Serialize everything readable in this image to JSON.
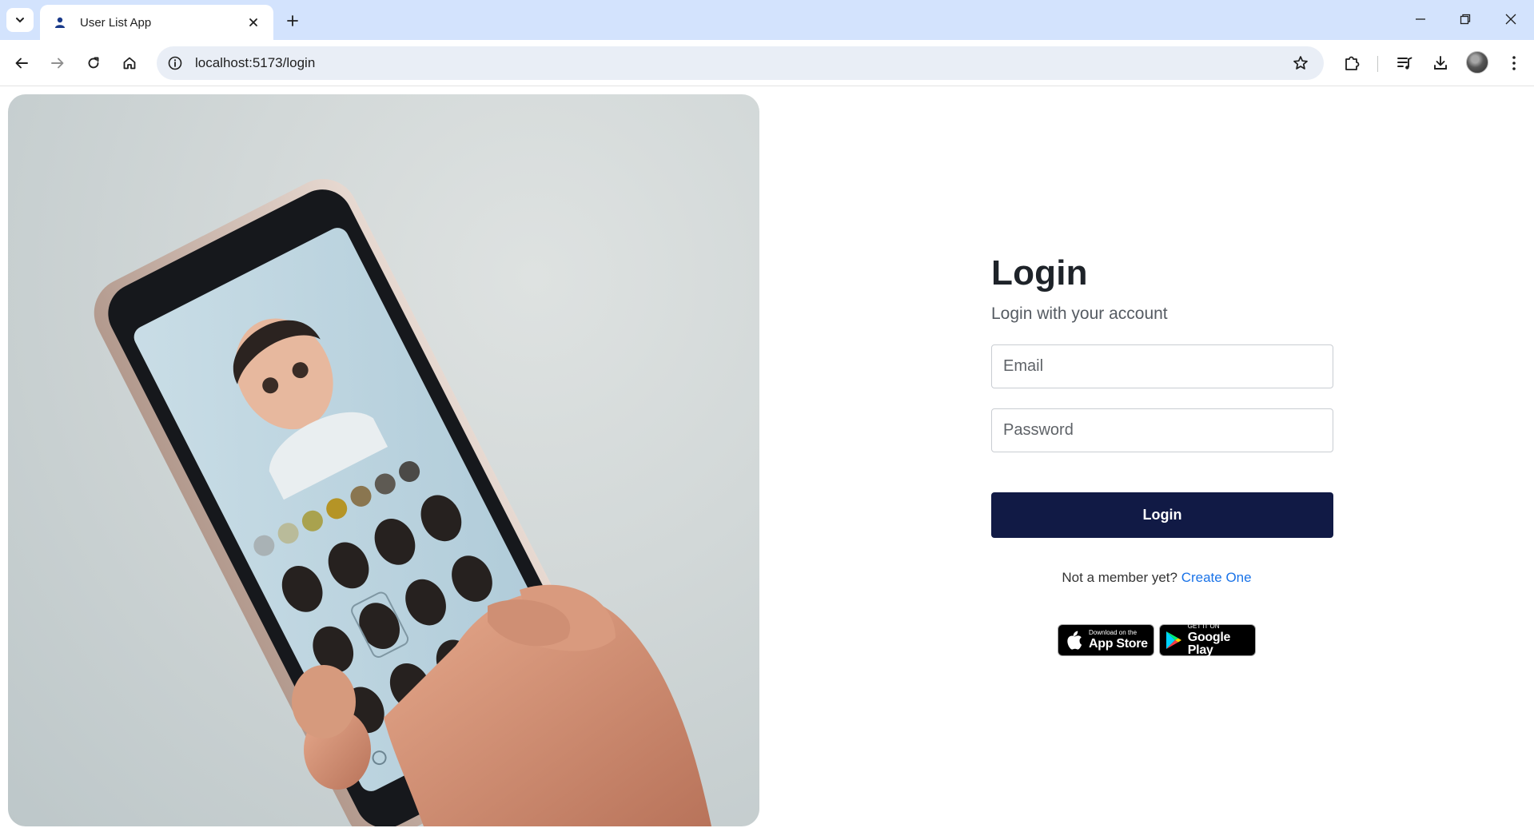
{
  "browser": {
    "tab_title": "User List App",
    "url": "localhost:5173/login"
  },
  "login": {
    "title": "Login",
    "subtitle": "Login with your account",
    "email_placeholder": "Email",
    "password_placeholder": "Password",
    "button_label": "Login",
    "member_prompt": "Not a member yet?",
    "create_link": "Create One"
  },
  "stores": {
    "apple_small": "Download on the",
    "apple_big": "App Store",
    "google_small": "GET IT ON",
    "google_big": "Google Play"
  },
  "colors": {
    "primary_button": "#111a45",
    "link": "#1a73e8",
    "tabstrip": "#d3e3fd"
  },
  "hero_image": {
    "depicts": "hand holding smartphone with avatar creator app"
  }
}
